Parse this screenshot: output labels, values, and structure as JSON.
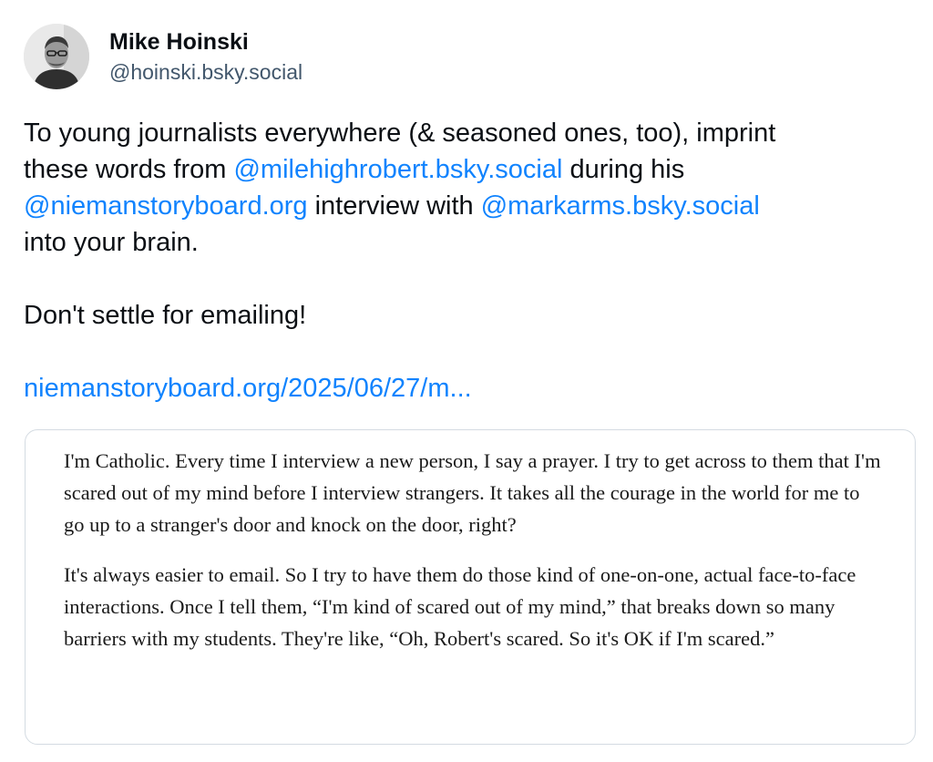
{
  "author": {
    "display_name": "Mike Hoinski",
    "handle": "@hoinski.bsky.social",
    "avatar_icon": "profile-photo"
  },
  "post": {
    "line1": "To young journalists everywhere (& seasoned ones, too), imprint",
    "line2_prefix": "these words from ",
    "mention1": "@milehighrobert.bsky.social",
    "line2_suffix": " during his",
    "mention2": "@niemanstoryboard.org",
    "line3_middle": " interview with ",
    "mention3": "@markarms.bsky.social",
    "line4": "into your brain.",
    "line5": "Don't settle for emailing!",
    "link": "niemanstoryboard.org/2025/06/27/m..."
  },
  "quote": {
    "paragraph1": "I'm Catholic. Every time I interview a new person, I say a prayer. I try to get across to them that I'm scared out of my mind before I interview strangers. It takes all the courage in the world for me to go up to a stranger's door and knock on the door, right?",
    "paragraph2": "It's always easier to email. So I try to have them do those kind of one-on-one, actual face-to-face interactions. Once I tell them, “I'm kind of scared out of my mind,” that breaks down so many barriers with my students. They're like, “Oh, Robert's scared. So it's OK if I'm scared.”"
  },
  "colors": {
    "link": "#1083fe",
    "handle": "#42576c",
    "text": "#0b0f14",
    "card_border": "#d4dbe2"
  }
}
